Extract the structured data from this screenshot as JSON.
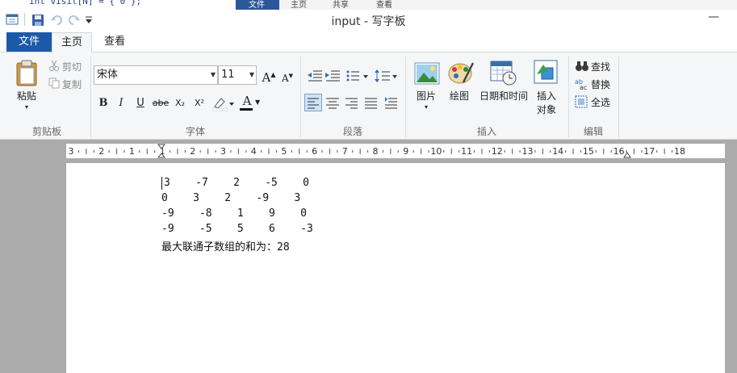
{
  "background_window": {
    "code_text": "int visit[N] = { 0 };",
    "tabs": [
      "文件",
      "主页",
      "共享",
      "查看"
    ]
  },
  "window": {
    "title": "input - 写字板",
    "minimize_glyph": "—"
  },
  "quick_access": {
    "icons": [
      "app-icon",
      "save-icon",
      "undo-icon",
      "redo-icon",
      "customize-icon"
    ]
  },
  "ribbon_tabs": {
    "file": "文件",
    "home": "主页",
    "view": "查看",
    "active": "主页"
  },
  "clipboard": {
    "group_label": "剪贴板",
    "paste": "粘贴",
    "cut": "剪切",
    "copy": "复制"
  },
  "font": {
    "group_label": "字体",
    "family": "宋体",
    "size": "11",
    "grow_glyph": "A",
    "shrink_glyph": "A",
    "bold": "B",
    "italic": "I",
    "underline": "U",
    "strike": "abe",
    "subscript": "X₂",
    "superscript": "X²",
    "font_color_glyph": "A"
  },
  "paragraph": {
    "group_label": "段落"
  },
  "insert": {
    "group_label": "插入",
    "picture": "图片",
    "paint": "绘图",
    "datetime": "日期和时间",
    "object_line1": "插入",
    "object_line2": "对象"
  },
  "editing": {
    "group_label": "编辑",
    "find": "查找",
    "replace": "替换",
    "select_all": "全选"
  },
  "ruler": {
    "labels": [
      "3",
      "2",
      "1",
      "1",
      "2",
      "3",
      "4",
      "5",
      "6",
      "7",
      "8",
      "9",
      "10",
      "11",
      "12",
      "13",
      "14",
      "15",
      "16",
      "17",
      "18"
    ]
  },
  "document": {
    "lines": [
      "3    -7    2    -5    0",
      "0    3    2    -9    3",
      "-9    -8    1    9    0",
      "-9    -5    5    6    -3",
      "最大联通子数组的和为：28"
    ]
  },
  "colors": {
    "file_tab": "#1c5aa9",
    "ribbon_bg": "#f5f6f7",
    "canvas_bg": "#ababab",
    "selected_button": "#cde3f7"
  }
}
